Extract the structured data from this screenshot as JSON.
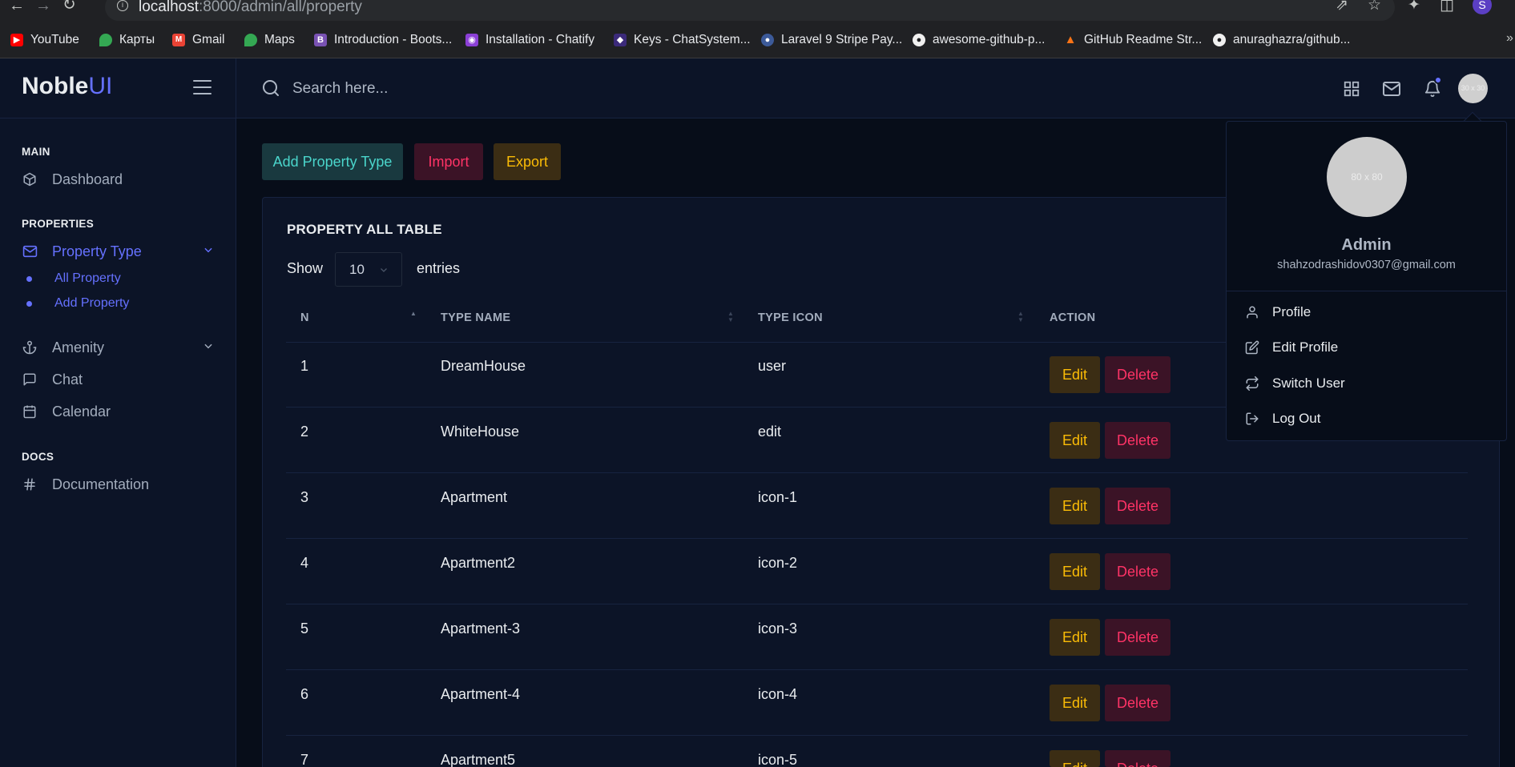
{
  "browser": {
    "url_host": "localhost",
    "url_path": ":8000/admin/all/property",
    "avatar_letter": "S",
    "bookmarks": [
      {
        "label": "YouTube",
        "color": "#ff0000",
        "icon": "youtube-icon"
      },
      {
        "label": "Карты",
        "color": "#34a853",
        "icon": "maps-pin-icon"
      },
      {
        "label": "Gmail",
        "color": "#ea4335",
        "icon": "gmail-icon"
      },
      {
        "label": "Maps",
        "color": "#34a853",
        "icon": "maps-pin-icon"
      },
      {
        "label": "Introduction - Boots...",
        "color": "#7952b3",
        "icon": "bootstrap-icon"
      },
      {
        "label": "Installation - Chatify",
        "color": "#8b3fd6",
        "icon": "chatify-icon"
      },
      {
        "label": "Keys - ChatSystem...",
        "color": "#3b2a7a",
        "icon": "chatsystem-icon"
      },
      {
        "label": "Laravel 9 Stripe Pay...",
        "color": "#3c5a99",
        "icon": "globe-icon"
      },
      {
        "label": "awesome-github-p...",
        "color": "#f0f0f0",
        "icon": "github-icon"
      },
      {
        "label": "GitHub Readme Str...",
        "color": "#f97316",
        "icon": "flame-icon"
      },
      {
        "label": "anuraghazra/github...",
        "color": "#f0f0f0",
        "icon": "github-icon"
      }
    ]
  },
  "sidebar": {
    "logo_main": "Noble",
    "logo_accent": "UI",
    "sections": {
      "main": "MAIN",
      "properties": "PROPERTIES",
      "docs": "DOCS"
    },
    "items": {
      "dashboard": "Dashboard",
      "property_type": "Property Type",
      "all_property": "All Property",
      "add_property": "Add Property",
      "amenity": "Amenity",
      "chat": "Chat",
      "calendar": "Calendar",
      "documentation": "Documentation"
    }
  },
  "topbar": {
    "search_placeholder": "Search here...",
    "avatar_text": "30 x 30"
  },
  "toolbar": {
    "add_label": "Add Property Type",
    "import_label": "Import",
    "export_label": "Export"
  },
  "table": {
    "title": "PROPERTY ALL TABLE",
    "show_label": "Show",
    "page_length": "10",
    "entries_label": "entries",
    "columns": [
      "N",
      "TYPE NAME",
      "TYPE ICON",
      "ACTION"
    ],
    "edit_label": "Edit",
    "delete_label": "Delete",
    "rows": [
      {
        "n": "1",
        "name": "DreamHouse",
        "icon": "user"
      },
      {
        "n": "2",
        "name": "WhiteHouse",
        "icon": "edit"
      },
      {
        "n": "3",
        "name": "Apartment",
        "icon": "icon-1"
      },
      {
        "n": "4",
        "name": "Apartment2",
        "icon": "icon-2"
      },
      {
        "n": "5",
        "name": "Apartment-3",
        "icon": "icon-3"
      },
      {
        "n": "6",
        "name": "Apartment-4",
        "icon": "icon-4"
      },
      {
        "n": "7",
        "name": "Apartment5",
        "icon": "icon-5"
      }
    ]
  },
  "profile_menu": {
    "avatar_text": "80 x 80",
    "name": "Admin",
    "email": "shahzodrashidov0307@gmail.com",
    "items": {
      "profile": "Profile",
      "edit_profile": "Edit Profile",
      "switch_user": "Switch User",
      "log_out": "Log Out"
    }
  },
  "colors": {
    "primary": "#6571ff",
    "success": "#4ad5cb",
    "danger": "#ff3366",
    "warning": "#fbbc06",
    "sidebar_bg": "#0c1427",
    "page_bg": "#070d19"
  }
}
